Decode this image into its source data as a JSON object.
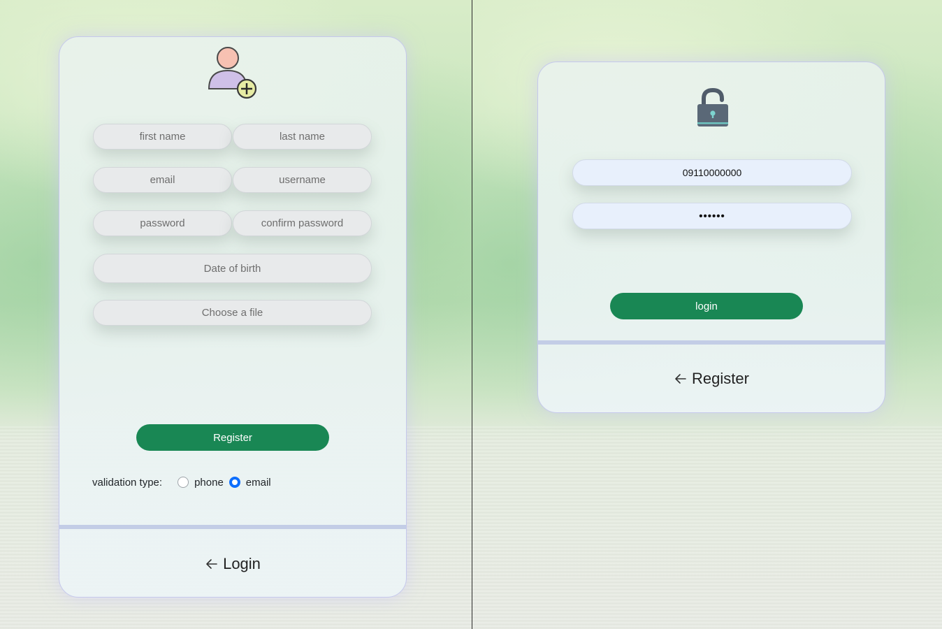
{
  "register_form": {
    "fields": {
      "first_name": "first name",
      "last_name": "last name",
      "email": "email",
      "username": "username",
      "password": "password",
      "confirm_password": "confirm password",
      "date_of_birth": "Date of birth",
      "file": "Choose a file"
    },
    "submit_label": "Register",
    "validation": {
      "label": "validation type:",
      "options": [
        "phone",
        "email"
      ],
      "selected": "email"
    },
    "footer_link": "Login",
    "icon": "add-user-icon"
  },
  "login_form": {
    "phone_value": "09110000000",
    "password_value": "••••••",
    "submit_label": "login",
    "footer_link": "Register",
    "icon": "unlock-icon"
  },
  "colors": {
    "primary": "#198754",
    "radio_checked": "#0d6efd",
    "card_border": "#c5c8ec"
  }
}
